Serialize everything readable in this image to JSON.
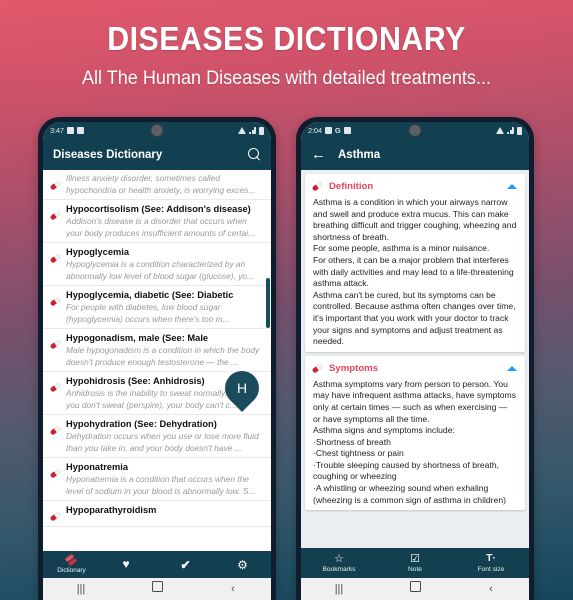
{
  "banner": {
    "title": "DISEASES  DICTIONARY",
    "subtitle": "All The Human Diseases with detailed treatments..."
  },
  "colors": {
    "header": "#134050",
    "accent_red": "#e8455a",
    "pill_red": "#cf2030",
    "chevron_blue": "#2196f3",
    "bubble": "#1a4c5e"
  },
  "left_phone": {
    "status_bar": {
      "time": "3:47",
      "icons": [
        "image-icon",
        "app-icon",
        "mute-icon",
        "signal-icon",
        "battery-icon"
      ]
    },
    "app_bar": {
      "title": "Diseases Dictionary",
      "search_icon": "search-icon"
    },
    "fast_scroll_letter": "H",
    "list_items": [
      {
        "title": "",
        "desc": "Illness anxiety disorder, sometimes called hypochondria or health anxiety, is worrying exces..."
      },
      {
        "title": "Hypocortisolism (See: Addison's disease)",
        "desc": "Addison's disease is a disorder that occurs when your body produces insufficient amounts of certai..."
      },
      {
        "title": "Hypoglycemia",
        "desc": "Hypoglycemia is a condition characterized by an abnormally low level of blood sugar (glucose), yo..."
      },
      {
        "title": "Hypoglycemia, diabetic (See: Diabetic",
        "desc": "For people with diabetes, low blood sugar (hypoglycemia) occurs when there's too m..."
      },
      {
        "title": "Hypogonadism, male (See: Male",
        "desc": "Male hypogonadism is a condition in which the body doesn't produce enough testosterone — the ..."
      },
      {
        "title": "Hypohidrosis (See: Anhidrosis)",
        "desc": "Anhidrosis is the inability to sweat normally. When you don't sweat (perspire), your body can't c..."
      },
      {
        "title": "Hypohydration (See: Dehydration)",
        "desc": "Dehydration occurs when you use or lose more fluid than you take in, and your body doesn't have ..."
      },
      {
        "title": "Hyponatremia",
        "desc": "Hyponatremia is a condition that occurs when the level of sodium in your blood is abnormally low. S..."
      },
      {
        "title": "Hypoparathyroidism",
        "desc": ""
      }
    ],
    "bottom_nav": [
      {
        "label": "Dictionary",
        "icon": "pills-icon"
      },
      {
        "label": "",
        "icon": "heart-icon"
      },
      {
        "label": "",
        "icon": "check-icon"
      },
      {
        "label": "",
        "icon": "gear-icon"
      }
    ]
  },
  "right_phone": {
    "status_bar": {
      "time": "2:04",
      "icons": [
        "image-icon",
        "google-icon",
        "app-icon",
        "mute-icon",
        "signal-icon",
        "battery-icon"
      ]
    },
    "app_bar": {
      "back_icon": "back-arrow-icon",
      "title": "Asthma"
    },
    "sections": [
      {
        "title": "Definition",
        "icon": "pills-icon",
        "chevron": "chevron-up-icon",
        "body": "Asthma is a condition in which your airways narrow and swell and produce extra mucus. This can make breathing difficult and trigger coughing, wheezing and shortness of breath.\nFor some people, asthma is a minor nuisance.\nFor others, it can be a major problem that interferes with daily activities and may lead to a life-threatening asthma attack.\nAsthma can't be cured, but its symptoms can be controlled. Because asthma often changes over time, it's important that you work with your doctor to track your signs and symptoms and adjust treatment as needed."
      },
      {
        "title": "Symptoms",
        "icon": "pills-icon",
        "chevron": "chevron-up-icon",
        "body": "Asthma symptoms vary from person to person. You may have infrequent asthma attacks, have symptoms only at certain times — such as when exercising — or have symptoms all the time.\nAsthma signs and symptoms include:\n·Shortness of breath\n·Chest tightness or pain\n·Trouble sleeping caused by shortness of breath, coughing or wheezing\n·A whistling or wheezing sound when exhaling (wheezing is a common sign of asthma in children)"
      }
    ],
    "toolbar": [
      {
        "label": "Bookmarks",
        "icon": "star-icon"
      },
      {
        "label": "Note",
        "icon": "note-check-icon"
      },
      {
        "label": "Font size",
        "icon": "font-size-icon"
      }
    ]
  },
  "android_nav": {
    "recents": "recents-icon",
    "home": "home-icon",
    "back": "back-icon"
  }
}
